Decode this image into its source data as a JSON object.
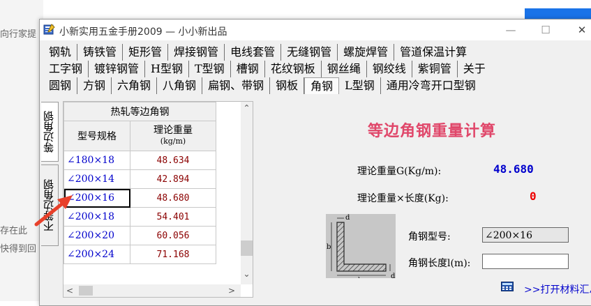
{
  "background": {
    "snippet_1": "向行家提",
    "snippet_2": "存在此",
    "snippet_3": "快得到回"
  },
  "window": {
    "title": "小新实用五金手册2009 — 小小新出品",
    "controls": {
      "minimize": "—",
      "maximize": "☐",
      "close": "✕"
    }
  },
  "tabs": {
    "row1": [
      "钢轨",
      "铸铁管",
      "矩形管",
      "焊接钢管",
      "电线套管",
      "无缝钢管",
      "螺旋焊管",
      "管道保温计算"
    ],
    "row2": [
      "工字钢",
      "镀锌钢管",
      "H型钢",
      "T型钢",
      "槽钢",
      "花纹钢板",
      "钢丝绳",
      "钢绞线",
      "紫铜管",
      "关于"
    ],
    "row3": [
      "圆钢",
      "方钢",
      "六角钢",
      "八角钢",
      "扁钢、带钢",
      "钢板",
      "角钢",
      "L型钢",
      "通用冷弯开口型钢"
    ],
    "active": "角钢"
  },
  "side_tabs": [
    "等边角钢",
    "不等边角钢"
  ],
  "table": {
    "group_header": "热轧等边角钢",
    "columns": [
      "型号规格",
      "理论重量",
      "(kg/m)"
    ],
    "rows": [
      {
        "spec": "∠180×18",
        "weight": "48.634"
      },
      {
        "spec": "∠200×14",
        "weight": "42.894"
      },
      {
        "spec": "∠200×16",
        "weight": "48.680"
      },
      {
        "spec": "∠200×18",
        "weight": "54.401"
      },
      {
        "spec": "∠200×20",
        "weight": "60.056"
      },
      {
        "spec": "∠200×24",
        "weight": "71.168"
      }
    ],
    "selected_spec": "∠200×16"
  },
  "calculator": {
    "title": "等边角钢重量计算",
    "weight_label": "理论重量G(Kg/m):",
    "weight_value": "48.680",
    "total_label": "理论重量×长度(Kg):",
    "total_value": "0",
    "model_label": "角钢型号:",
    "model_value": "∠200×16",
    "length_label": "角钢长度l(m):",
    "length_value": "",
    "diagram_labels": {
      "d": "d",
      "b": "b"
    },
    "open_link": ">>打开材料汇总"
  },
  "colors": {
    "title_pink": "#e0476a",
    "value_blue": "#0000cc",
    "value_red": "#ee0000",
    "spec_blue": "#0000cc",
    "weight_darkred": "#8b0000",
    "annotation_arrow": "#e8402a"
  },
  "icons": {
    "app": "book-icon",
    "calculator": "calculator-icon"
  }
}
